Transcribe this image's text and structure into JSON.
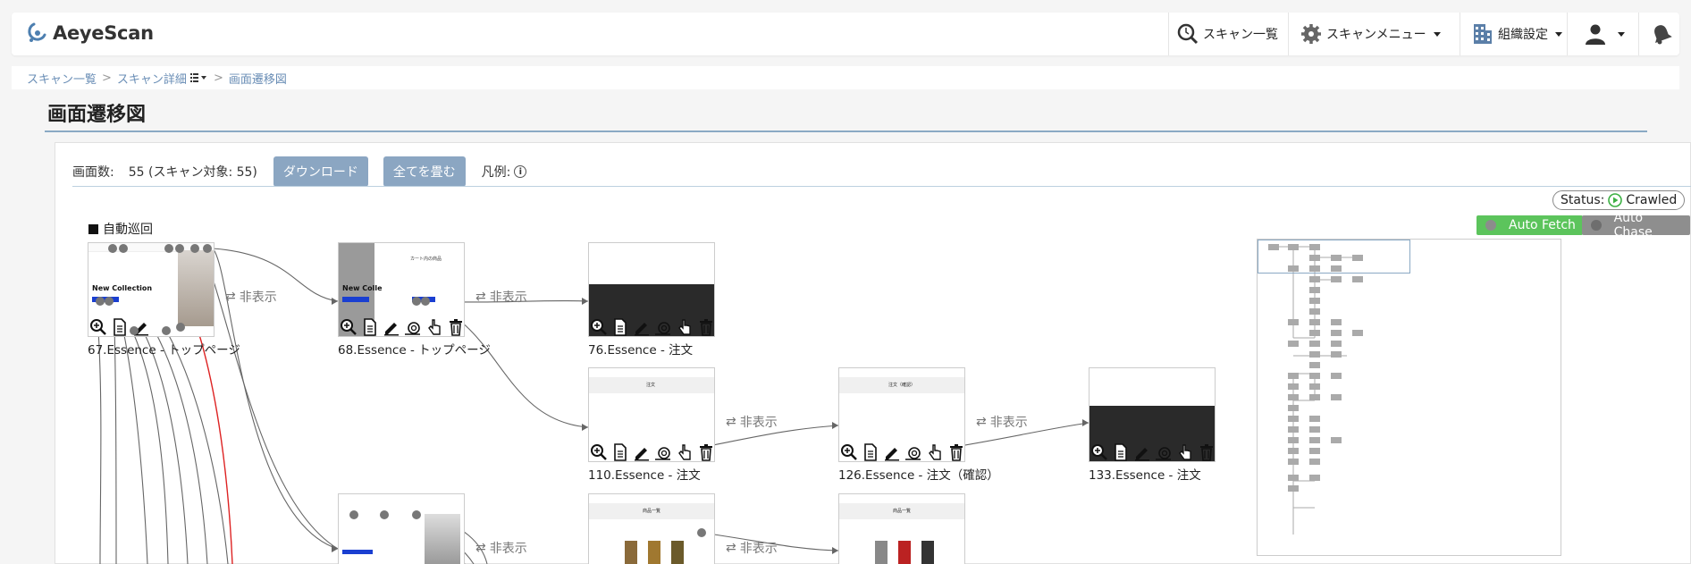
{
  "app": {
    "name": "AeyeScan"
  },
  "nav": {
    "scan_list": "スキャン一覧",
    "scan_menu": "スキャンメニュー",
    "org_settings": "組織設定"
  },
  "breadcrumb": {
    "item1": "スキャン一覧",
    "item2": "スキャン詳細",
    "item3": "画面遷移図"
  },
  "page": {
    "title": "画面遷移図"
  },
  "toolbar": {
    "count_label": "画面数:",
    "count_value": "55 (スキャン対象: 55)",
    "download": "ダウンロード",
    "collapse_all": "全てを畳む",
    "legend": "凡例:"
  },
  "status": {
    "label": "Status:",
    "value": "Crawled"
  },
  "tags": {
    "auto_fetch": "Auto Fetch",
    "auto_chase": "Auto Chase"
  },
  "section": {
    "label": "自動巡回"
  },
  "hide_label": "非表示",
  "nodes": [
    {
      "label": "67.Essence - トップページ",
      "thumb_text": "New Collection"
    },
    {
      "label": "68.Essence - トップページ",
      "thumb_text": "New Colle",
      "side_text": "カート内の商品"
    },
    {
      "label": "76.Essence - 注文"
    },
    {
      "label": "110.Essence - 注文",
      "thumb_text": "注文"
    },
    {
      "label": "126.Essence - 注文（確認）",
      "thumb_text": "注文（確認）"
    },
    {
      "label": "133.Essence - 注文"
    },
    {
      "label": ""
    },
    {
      "label": "",
      "thumb_text": "商品一覧"
    },
    {
      "label": "",
      "thumb_text": "商品一覧"
    }
  ],
  "colors": {
    "accent": "#8ba6c2",
    "auto_fetch": "#5cc45c",
    "auto_chase": "#8e8e8e",
    "status_green": "#3cb043"
  }
}
